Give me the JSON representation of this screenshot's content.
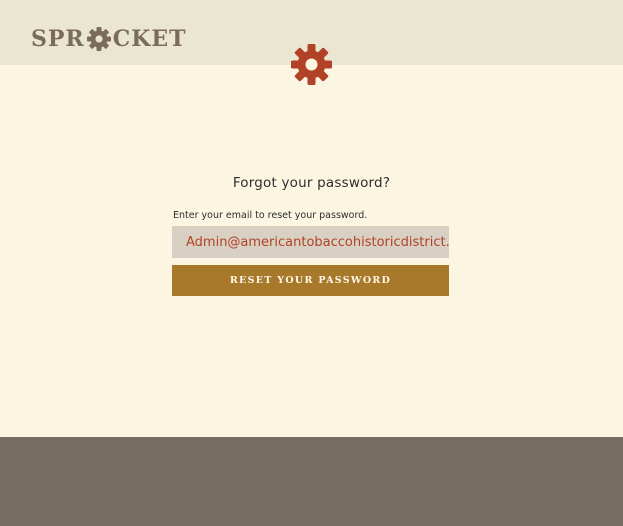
{
  "header": {
    "logo_left": "SPR",
    "logo_right": "CKET",
    "logo_icon": "gear-icon"
  },
  "main": {
    "decoration_icon": "gear-icon",
    "title": "Forgot your password?",
    "email_label": "Enter your email to reset your password.",
    "email_value": "Admin@americantobaccohistoricdistrict.com",
    "reset_button_label": "RESET YOUR PASSWORD"
  },
  "colors": {
    "page_background": "#fbf5e1",
    "header_background": "#ebe6d2",
    "logo": "#7a6b5c",
    "accent_gear": "#b14227",
    "button": "#a8792b",
    "input_background": "#d9d0c4",
    "footer": "#776c61"
  }
}
